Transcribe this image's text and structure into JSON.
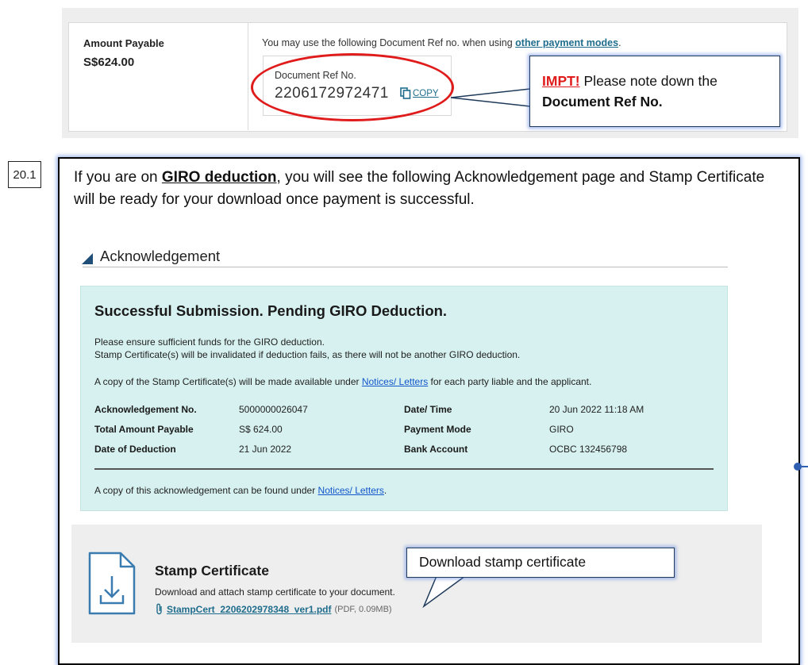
{
  "payment": {
    "amount_label": "Amount Payable",
    "amount_value": "S$624.00",
    "ref_notice_prefix": "You may use the following Document Ref no. when using ",
    "ref_notice_link": "other payment modes",
    "ref_notice_suffix": ".",
    "doc_ref_label": "Document Ref No.",
    "doc_ref_number": "2206172972471",
    "copy_label": "COPY"
  },
  "callout_top": {
    "impt": "IMPT!",
    "text": " Please note down the",
    "bold": "Document Ref No."
  },
  "step": {
    "number": "20.1",
    "intro_prefix": "If you are on ",
    "intro_bold": "GIRO deduction",
    "intro_suffix": ", you will see the following Acknowledgement page and Stamp Certificate will be ready for your download once payment is successful."
  },
  "acknowledgement": {
    "heading": "Acknowledgement",
    "title": "Successful Submission. Pending GIRO Deduction.",
    "line1": "Please ensure sufficient funds for the GIRO deduction.",
    "line2": "Stamp Certificate(s) will be invalidated if deduction fails, as there will not be another GIRO deduction.",
    "line3_prefix": "A copy of the Stamp Certificate(s) will be made available under ",
    "line3_link": "Notices/ Letters",
    "line3_suffix": " for each party liable and the applicant.",
    "fields": [
      {
        "key": "Acknowledgement No.",
        "value": "5000000026047"
      },
      {
        "key": "Date/ Time",
        "value": "20 Jun 2022 11:18 AM"
      },
      {
        "key": "Total Amount Payable",
        "value": "S$ 624.00"
      },
      {
        "key": "Payment Mode",
        "value": "GIRO"
      },
      {
        "key": "Date of Deduction",
        "value": "21 Jun 2022"
      },
      {
        "key": "Bank Account",
        "value": "OCBC 132456798"
      }
    ],
    "footer_prefix": "A copy of this acknowledgement can be found under ",
    "footer_link": "Notices/ Letters",
    "footer_suffix": "."
  },
  "stamp": {
    "title": "Stamp Certificate",
    "description": "Download and attach stamp certificate to your document.",
    "file_name": "StampCert_2206202978348_ver1.pdf",
    "file_meta": "(PDF, 0.09MB)",
    "icon": "file-download-icon"
  },
  "callout_bottom": {
    "text": "Download stamp certificate"
  },
  "colors": {
    "highlight_red": "#e01b1b",
    "ack_background": "#d6f1ef",
    "link_blue": "#1155cc",
    "callout_glow": "#5a82dc"
  }
}
